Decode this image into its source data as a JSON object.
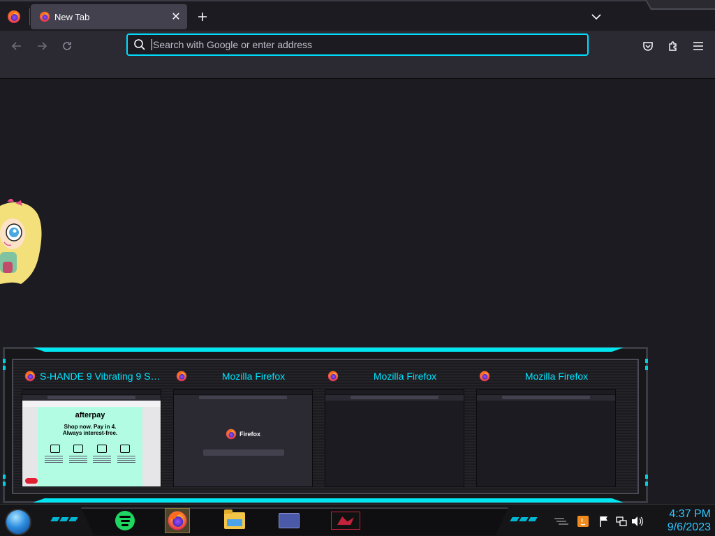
{
  "browser": {
    "tab": {
      "title": "New Tab"
    },
    "urlbar": {
      "placeholder": "Search with Google or enter address"
    }
  },
  "task_preview": {
    "windows": [
      {
        "title": "S-HANDE 9 Vibrating 9 Suc...",
        "content": "afterpay",
        "afterpay": {
          "logo": "afterpay",
          "line1": "Shop now. Pay in 4.",
          "line2": "Always interest-free."
        }
      },
      {
        "title": "Mozilla Firefox",
        "content": "firefox-home",
        "brand": "Firefox"
      },
      {
        "title": "Mozilla Firefox",
        "content": "blank"
      },
      {
        "title": "Mozilla Firefox",
        "content": "blank"
      }
    ]
  },
  "taskbar": {
    "apps": [
      "spotify",
      "firefox",
      "file-explorer",
      "control-panel",
      "game"
    ],
    "active_app": "firefox",
    "clock": {
      "time": "4:37 PM",
      "date": "9/6/2023"
    }
  },
  "colors": {
    "accent_cyan": "#00e5ff",
    "urlbar_focus": "#00ddff",
    "clock": "#2ec6ff"
  }
}
